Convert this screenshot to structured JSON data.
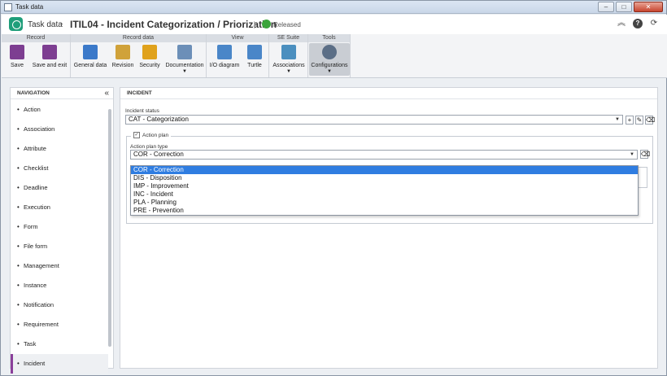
{
  "window": {
    "title": "Task data"
  },
  "header": {
    "breadcrumb_root": "Task data",
    "separator": "›",
    "record_title": "ITIL04 - Incident Categorization / Priorization",
    "status": "Released"
  },
  "ribbon": {
    "groups": {
      "record": "Record",
      "record_data": "Record data",
      "view": "View",
      "se_suite": "SE Suite",
      "tools": "Tools"
    },
    "buttons": {
      "save": "Save",
      "save_exit": "Save and exit",
      "general_data": "General data",
      "revision": "Revision",
      "security": "Security",
      "documentation": "Documentation",
      "io_diagram": "I/O diagram",
      "turtle": "Turtle",
      "associations": "Associations",
      "configurations": "Configurations"
    }
  },
  "navigation": {
    "title": "NAVIGATION",
    "items": [
      "Action",
      "Association",
      "Attribute",
      "Checklist",
      "Deadline",
      "Execution",
      "Form",
      "File form",
      "Management",
      "Instance",
      "Notification",
      "Requirement",
      "Task",
      "Incident"
    ],
    "selected": "Incident"
  },
  "panel": {
    "title": "INCIDENT",
    "incident_status_label": "Incident status",
    "incident_status_value": "CAT - Categorization",
    "action_plan_label": "Action plan",
    "action_plan_checked": true,
    "action_plan_type_label": "Action plan type",
    "action_plan_type_value": "COR - Correction"
  },
  "dropdown": {
    "options": [
      "COR - Correction",
      "DIS - Disposition",
      "IMP - Improvement",
      "INC - Incident",
      "PLA - Planning",
      "PRE - Prevention"
    ],
    "selected_index": 0
  },
  "colors": {
    "accent_selected": "#2f7de1",
    "nav_selected_bar": "#8a3f9a",
    "logo": "#1f9e7a",
    "status_badge": "#3aa43a"
  }
}
